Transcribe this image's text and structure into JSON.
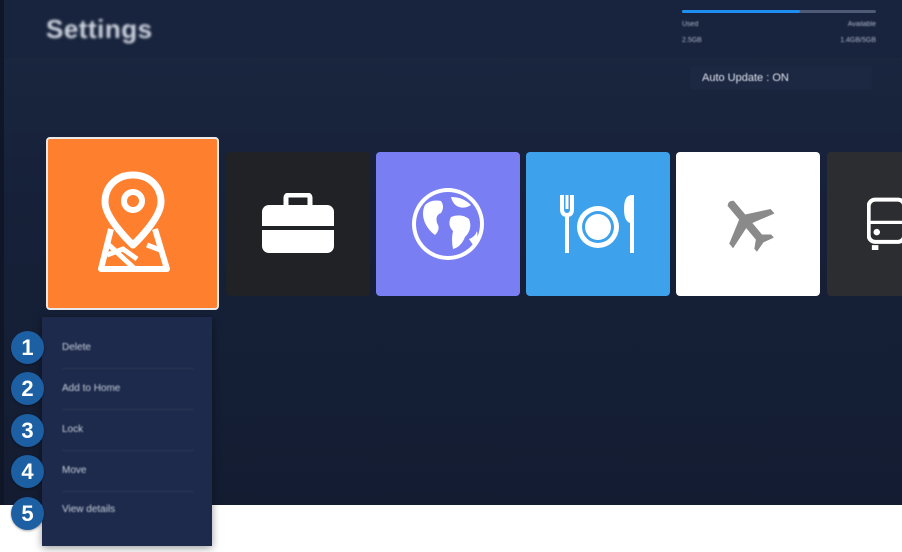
{
  "header": {
    "title": "Settings",
    "storage": {
      "used_label": "Used",
      "available_label": "Available",
      "used_value": "2.5GB",
      "available_value": "1.4GB/5GB",
      "used_fraction": 0.61
    },
    "auto_update": "Auto Update : ON"
  },
  "apps": [
    {
      "name": "map-icon",
      "color": "#fe7f2d"
    },
    {
      "name": "briefcase-icon",
      "color": "#212226"
    },
    {
      "name": "globe-icon",
      "color": "#7a7ef3"
    },
    {
      "name": "dining-icon",
      "color": "#3da1ec"
    },
    {
      "name": "airplane-icon",
      "color": "#ffffff"
    },
    {
      "name": "bus-icon",
      "color": "#2c2d30"
    }
  ],
  "context_menu": {
    "items": [
      {
        "label": "Delete",
        "number": "1"
      },
      {
        "label": "Add to Home",
        "number": "2"
      },
      {
        "label": "Lock",
        "number": "3"
      },
      {
        "label": "Move",
        "number": "4"
      },
      {
        "label": "View details",
        "number": "5"
      }
    ]
  },
  "colors": {
    "callout": "#1c5fa3",
    "accent": "#1f8ef1"
  }
}
